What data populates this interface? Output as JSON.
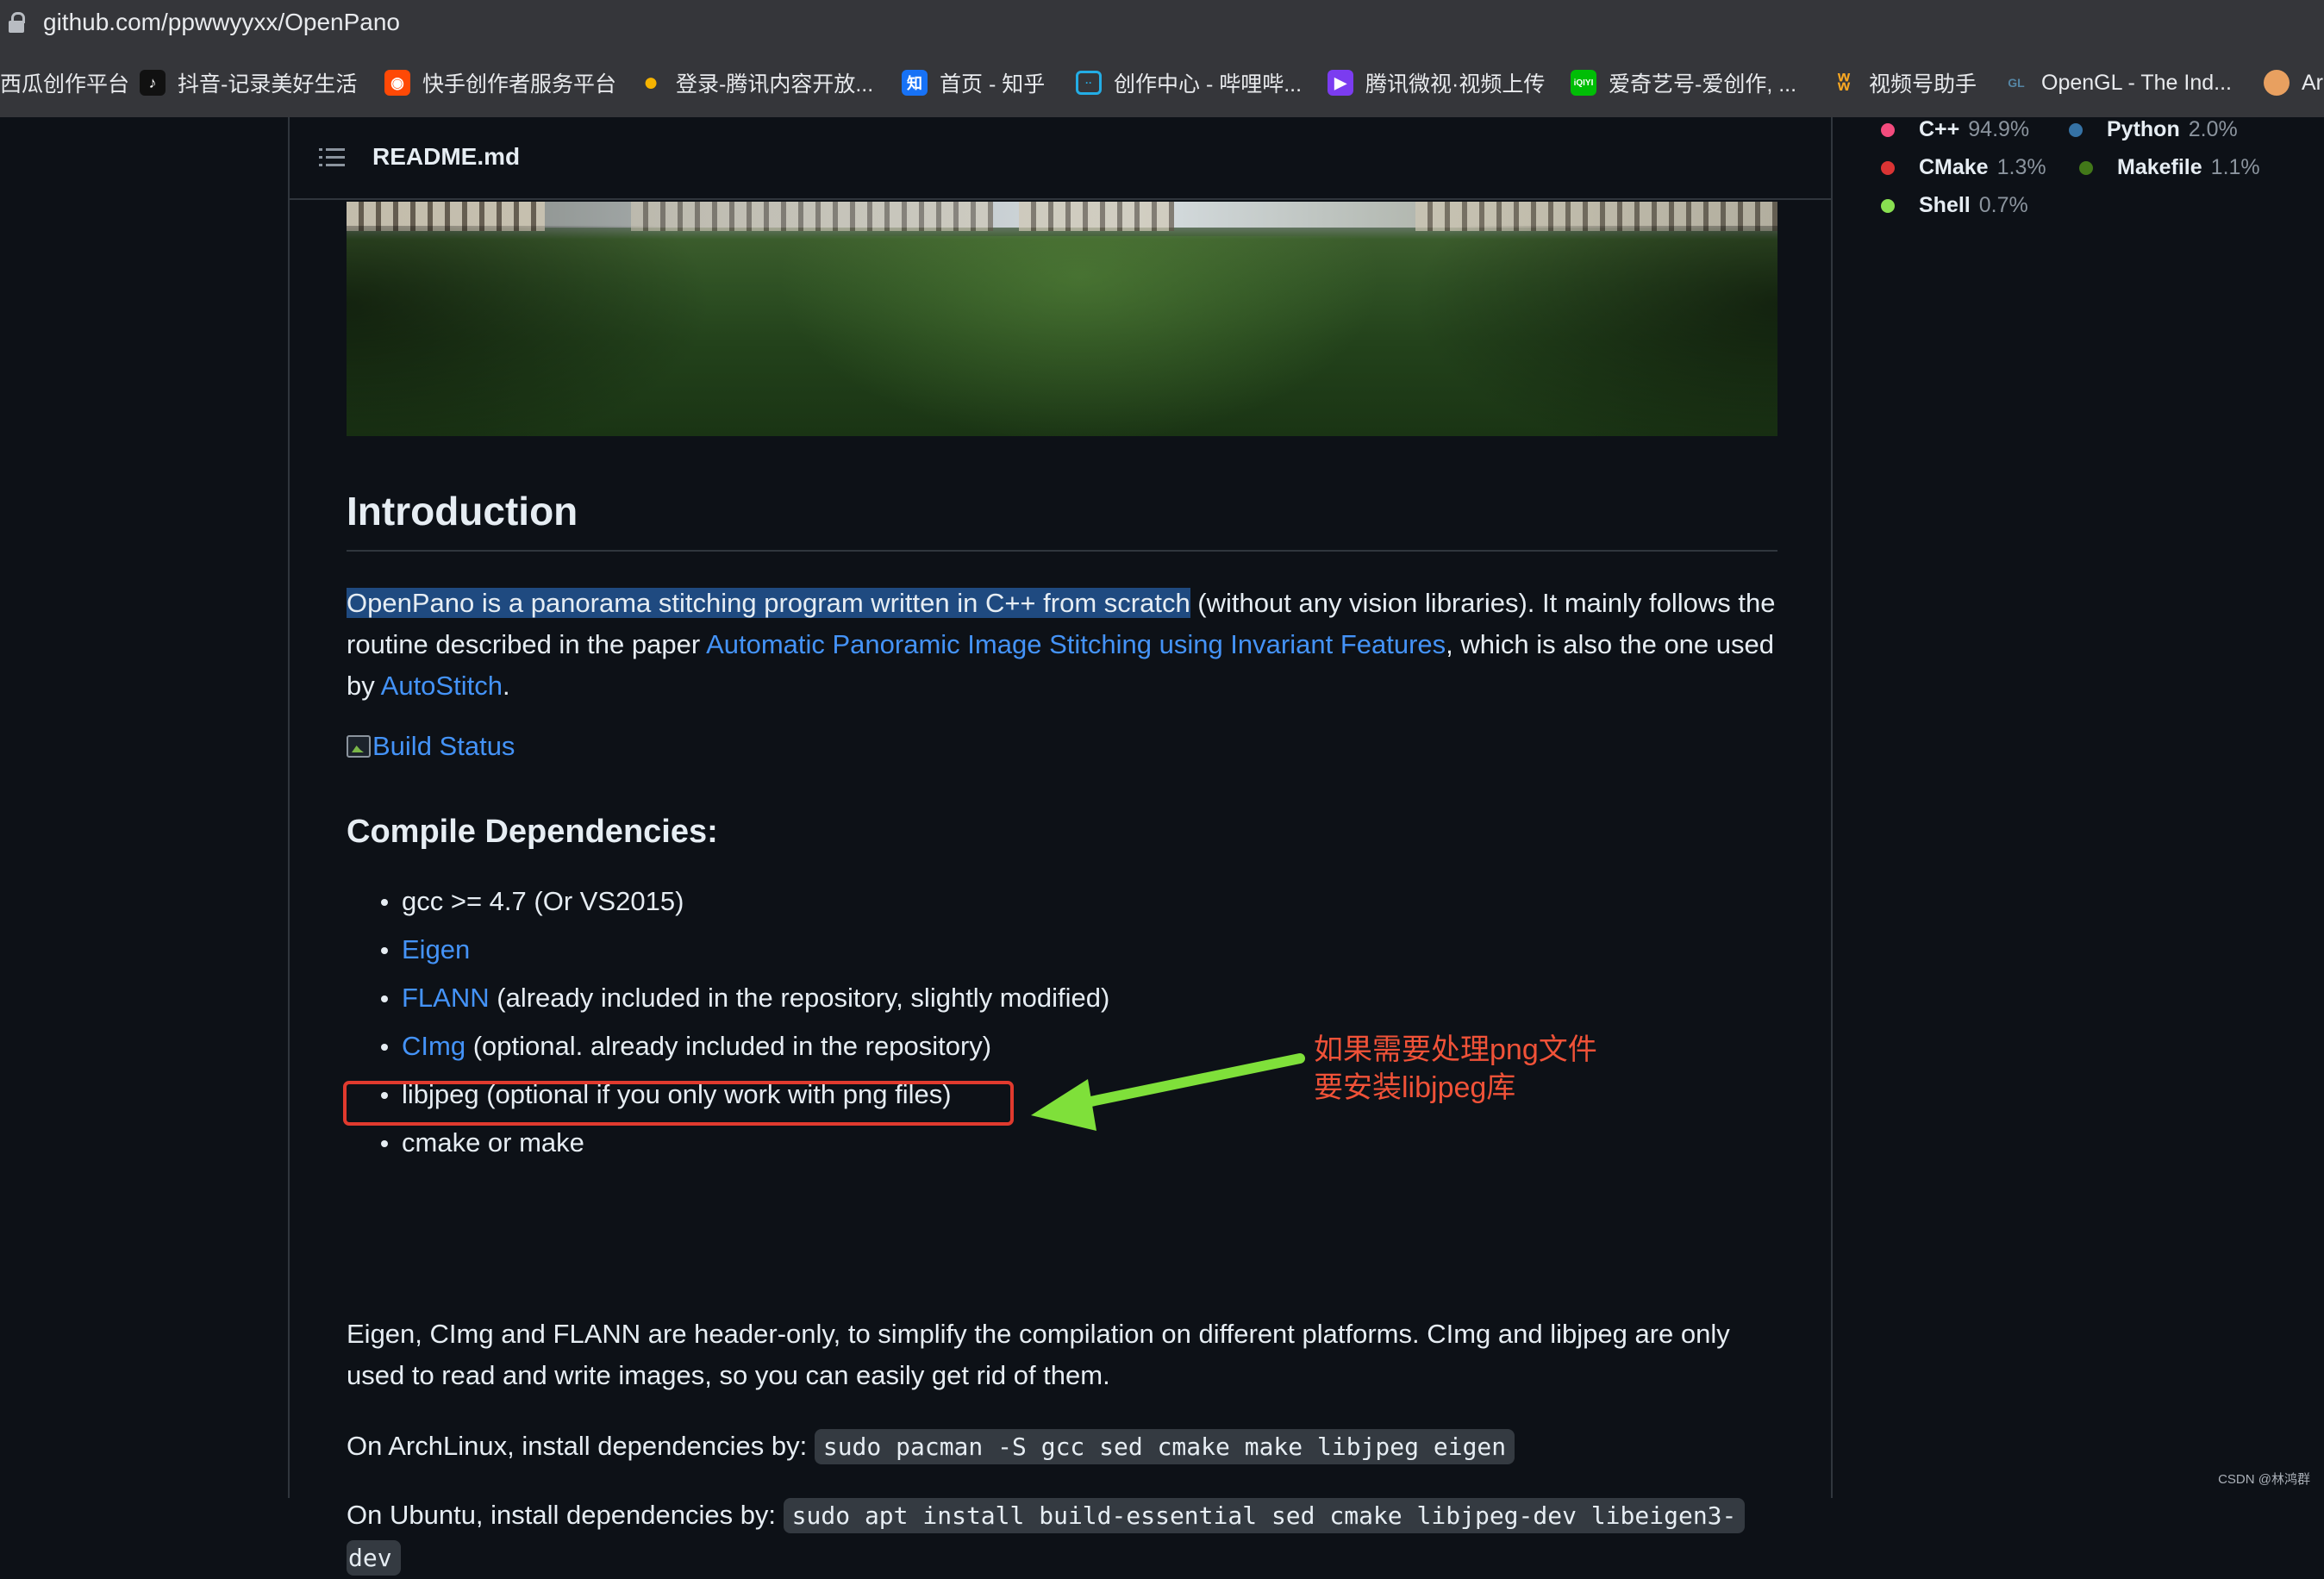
{
  "browser": {
    "url": "github.com/ppwwyyxx/OpenPano",
    "bookmarks": [
      {
        "label": "西瓜创作平台",
        "icon": "xigua-icon",
        "color": "#35363a"
      },
      {
        "label": "抖音-记录美好生活",
        "icon": "douyin-icon",
        "color": "#111111"
      },
      {
        "label": "快手创作者服务平台",
        "icon": "kuaishou-icon",
        "color": "#ff4906"
      },
      {
        "label": "登录-腾讯内容开放...",
        "icon": "tencent-bell-icon",
        "color": "#f5b301"
      },
      {
        "label": "首页 - 知乎",
        "icon": "zhihu-icon",
        "color": "#1772f6"
      },
      {
        "label": "创作中心 - 哔哩哔...",
        "icon": "bilibili-icon",
        "color": "#23ade5"
      },
      {
        "label": "腾讯微视·视频上传",
        "icon": "weishi-icon",
        "color": "#7b3cf0"
      },
      {
        "label": "爱奇艺号-爱创作, ...",
        "icon": "iqiyi-icon",
        "color": "#00be06"
      },
      {
        "label": "视频号助手",
        "icon": "channels-icon",
        "color": "#f6a623"
      },
      {
        "label": "OpenGL - The Ind...",
        "icon": "opengl-icon",
        "color": "#5586a4"
      },
      {
        "label": "Ar",
        "icon": "bookmark-icon",
        "color": "#e8a060"
      }
    ]
  },
  "readme": {
    "filename": "README.md"
  },
  "article": {
    "intro_heading": "Introduction",
    "intro_highlight": "OpenPano is a panorama stitching program written in C++ from scratch",
    "intro_rest1": " (without any vision libraries). It mainly follows the routine described in the paper ",
    "intro_link1": "Automatic Panoramic Image Stitching using Invariant Features",
    "intro_rest2": ", which is also the one used by ",
    "intro_link2": "AutoStitch",
    "intro_end": ".",
    "badge_alt": "Build Status",
    "deps_heading": "Compile Dependencies:",
    "deps": [
      {
        "link": "",
        "text": "gcc >= 4.7 (Or VS2015)"
      },
      {
        "link": "Eigen",
        "text": ""
      },
      {
        "link": "FLANN",
        "text": " (already included in the repository, slightly modified)"
      },
      {
        "link": "CImg",
        "text": " (optional. already included in the repository)"
      },
      {
        "link": "",
        "text": "libjpeg (optional if you only work with png files)"
      },
      {
        "link": "",
        "text": "cmake or make"
      }
    ],
    "header_only_note": "Eigen, CImg and FLANN are header-only, to simplify the compilation on different platforms. CImg and libjpeg are only used to read and write images, so you can easily get rid of them.",
    "arch_label": "On ArchLinux, install dependencies by: ",
    "arch_cmd": "sudo pacman -S gcc sed cmake make libjpeg eigen",
    "ubuntu_label": "On Ubuntu, install dependencies by: ",
    "ubuntu_cmd1": "sudo apt install build-essential sed cmake libjpeg-dev libeigen3-",
    "ubuntu_cmd2": "dev"
  },
  "annotation": {
    "line1": "如果需要处理png文件",
    "line2": "要安装libjpeg库",
    "text_color": "#f05238",
    "box_color": "#e03a2e",
    "arrow_color": "#7fe03a"
  },
  "languages": [
    {
      "name": "C++",
      "pct": "94.9%",
      "color": "#f34b7d"
    },
    {
      "name": "Python",
      "pct": "2.0%",
      "color": "#3572a5"
    },
    {
      "name": "CMake",
      "pct": "1.3%",
      "color": "#da3434"
    },
    {
      "name": "Makefile",
      "pct": "1.1%",
      "color": "#427819"
    },
    {
      "name": "Shell",
      "pct": "0.7%",
      "color": "#89e051"
    }
  ],
  "watermark": "CSDN @林鸿群"
}
